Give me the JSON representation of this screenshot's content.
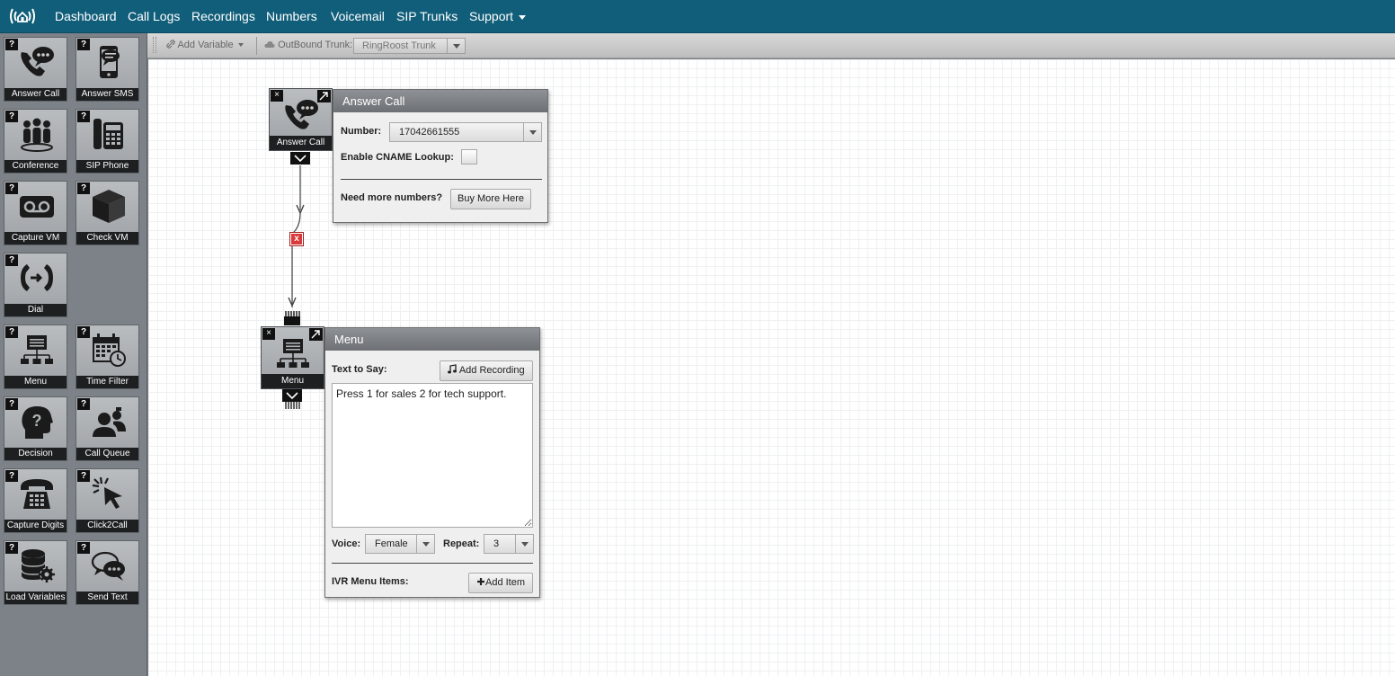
{
  "nav": {
    "items": [
      {
        "label": "Dashboard"
      },
      {
        "label": "Call Logs"
      },
      {
        "label": "Recordings"
      },
      {
        "label": "Numbers"
      },
      {
        "label": "Voicemail"
      },
      {
        "label": "SIP Trunks"
      },
      {
        "label": "Support"
      }
    ]
  },
  "toolbar": {
    "add_variable": "Add Variable",
    "outbound_label": "OutBound Trunk:",
    "trunk_value": "RingRoost Trunk"
  },
  "palette": {
    "help_glyph": "?",
    "tools": [
      {
        "label": "Answer Call",
        "icon": "phone-chat-icon"
      },
      {
        "label": "Answer SMS",
        "icon": "sms-phone-icon"
      },
      {
        "label": "Conference",
        "icon": "conference-icon"
      },
      {
        "label": "SIP Phone",
        "icon": "sip-phone-icon"
      },
      {
        "label": "Capture VM",
        "icon": "voicemail-icon"
      },
      {
        "label": "Check VM",
        "icon": "box-icon"
      },
      {
        "label": "Dial",
        "icon": "dial-icon"
      },
      {
        "label": "Menu",
        "icon": "menu-tree-icon"
      },
      {
        "label": "Time Filter",
        "icon": "calendar-clock-icon"
      },
      {
        "label": "Decision",
        "icon": "decision-head-icon"
      },
      {
        "label": "Call Queue",
        "icon": "call-queue-icon"
      },
      {
        "label": "Capture Digits",
        "icon": "keypad-phone-icon"
      },
      {
        "label": "Click2Call",
        "icon": "cursor-click-icon"
      },
      {
        "label": "Load Variables",
        "icon": "database-gear-icon"
      },
      {
        "label": "Send Text",
        "icon": "chat-bubbles-icon"
      }
    ]
  },
  "flow": {
    "answer_node": {
      "label": "Answer Call",
      "close": "×"
    },
    "menu_node": {
      "label": "Menu",
      "close": "×"
    },
    "delete_link": "x",
    "answer_panel": {
      "title": "Answer Call",
      "number_label": "Number:",
      "number_value": "17042661555",
      "cname_label": "Enable CNAME Lookup:",
      "cname_checked": false,
      "more_label": "Need more numbers?",
      "buy_button": "Buy More Here"
    },
    "menu_panel": {
      "title": "Menu",
      "text_label": "Text to Say:",
      "add_recording": "Add Recording",
      "text_value": "Press 1 for sales 2 for tech support.",
      "voice_label": "Voice:",
      "voice_value": "Female",
      "repeat_label": "Repeat:",
      "repeat_value": "3",
      "ivr_label": "IVR Menu Items:",
      "add_item": "Add Item"
    }
  },
  "colors": {
    "nav_bg": "#115e7a",
    "delete_red": "#d93a3a"
  }
}
